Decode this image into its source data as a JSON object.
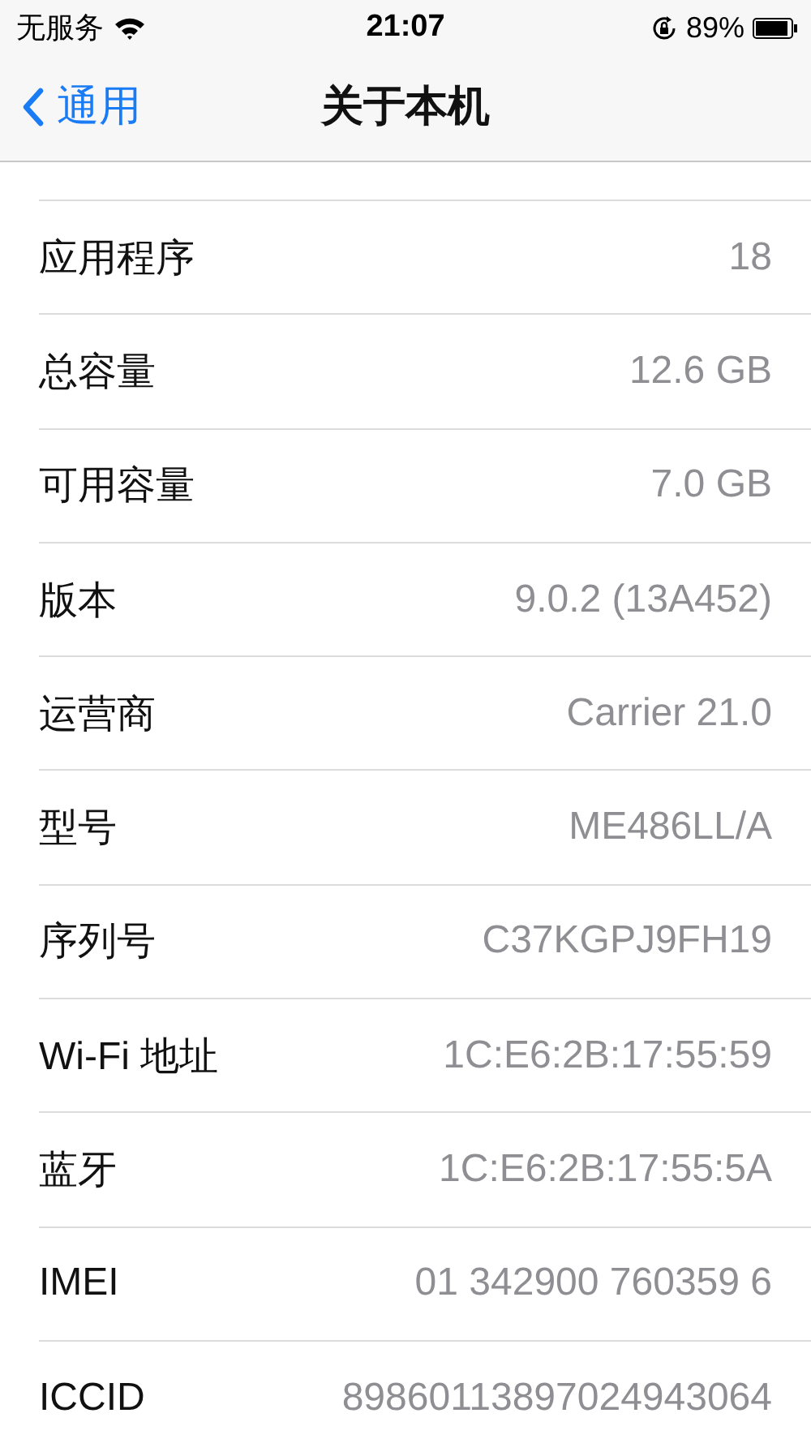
{
  "status_bar": {
    "carrier": "无服务",
    "time": "21:07",
    "battery_percent": "89%"
  },
  "nav_bar": {
    "back_label": "通用",
    "title": "关于本机"
  },
  "rows": [
    {
      "label": "应用程序",
      "value": "18"
    },
    {
      "label": "总容量",
      "value": "12.6 GB"
    },
    {
      "label": "可用容量",
      "value": "7.0 GB"
    },
    {
      "label": "版本",
      "value": "9.0.2 (13A452)"
    },
    {
      "label": "运营商",
      "value": "Carrier 21.0"
    },
    {
      "label": "型号",
      "value": "ME486LL/A"
    },
    {
      "label": "序列号",
      "value": "C37KGPJ9FH19"
    },
    {
      "label": "Wi-Fi 地址",
      "value": "1C:E6:2B:17:55:59"
    },
    {
      "label": "蓝牙",
      "value": "1C:E6:2B:17:55:5A"
    },
    {
      "label": "IMEI",
      "value": "01 342900 760359 6"
    },
    {
      "label": "ICCID",
      "value": "89860113897024943064"
    }
  ]
}
